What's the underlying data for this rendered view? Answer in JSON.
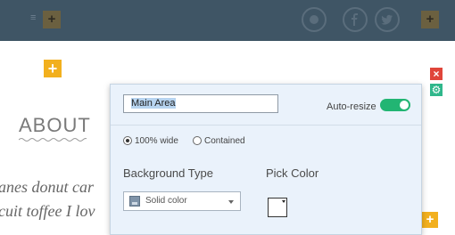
{
  "topbar": {
    "menu_glyph": "≡",
    "left_square_label": "+",
    "right_square_label": "+",
    "social": [
      "github-icon",
      "facebook-icon",
      "twitter-icon"
    ]
  },
  "content": {
    "add_label": "+",
    "about_title": "ABOUT",
    "text_line_1": "anes donut car",
    "text_line_2": "cuit toffee I lov"
  },
  "tools": {
    "close_label": "×",
    "gear_label": "⚙"
  },
  "panel": {
    "name_value": "Main Area",
    "auto_resize_label": "Auto-resize",
    "width_options": [
      {
        "label": "100% wide",
        "selected": true
      },
      {
        "label": "Contained",
        "selected": false
      }
    ],
    "background_type_title": "Background Type",
    "background_type_value": "Solid color",
    "pick_color_title": "Pick Color",
    "picked_color": "#ffffff"
  },
  "colors": {
    "topbar": "#3f5565",
    "add_button": "#f2b01e",
    "close_button": "#e0453a",
    "gear_button": "#2fb78b",
    "toggle_on": "#22b573",
    "panel_bg": "#eaf2fb"
  },
  "add_button_bottom_label": "+"
}
